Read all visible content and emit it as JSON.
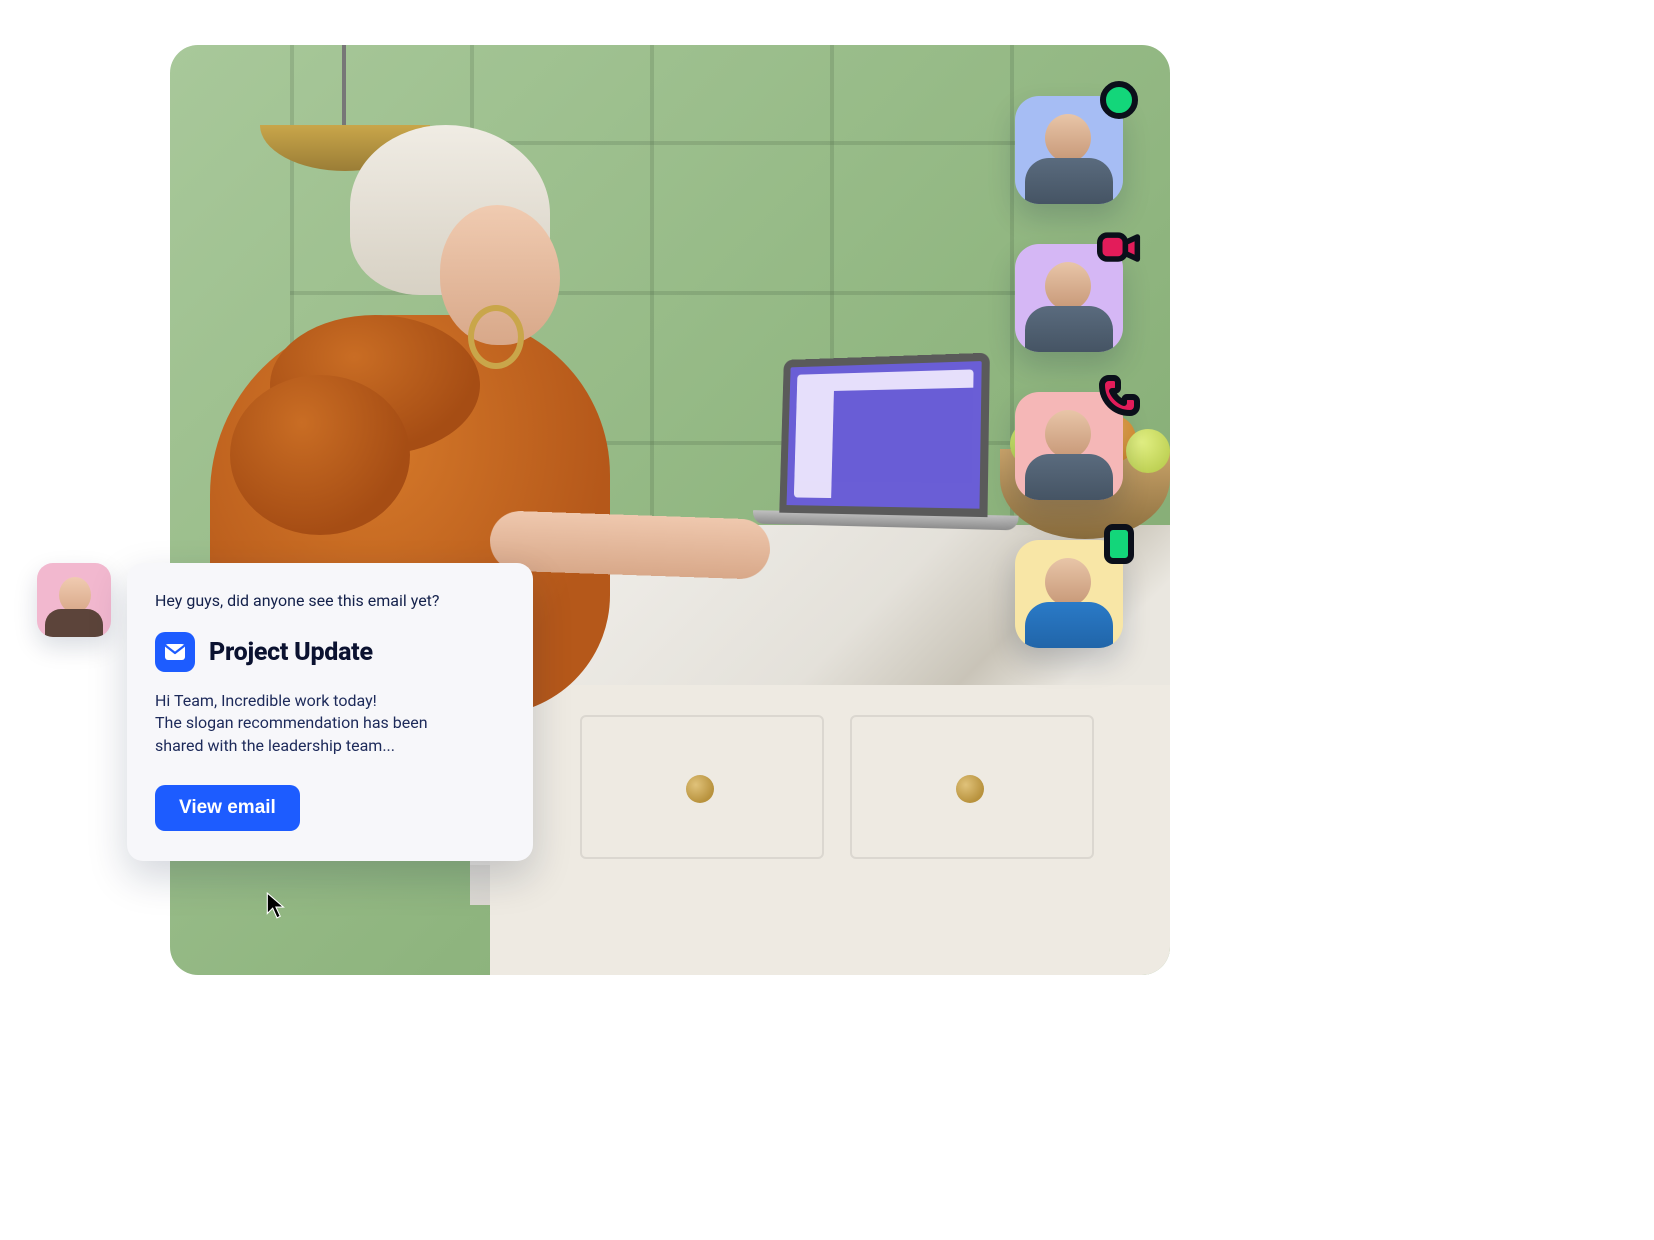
{
  "card": {
    "intro": "Hey guys, did anyone see this email yet?",
    "subject": "Project Update",
    "body": "Hi Team, Incredible work today!\nThe slogan recommendation has been\nshared with the leadership team...",
    "view_label": "View email"
  },
  "avatars": [
    {
      "name": "participant-1",
      "bg": "#a6bdf4",
      "status": "online"
    },
    {
      "name": "participant-2",
      "bg": "#d5b7f5",
      "status": "video"
    },
    {
      "name": "participant-3",
      "bg": "#f5b7b7",
      "status": "phone"
    },
    {
      "name": "participant-4",
      "bg": "#f8e6a6",
      "status": "mobile"
    }
  ],
  "colors": {
    "primary_blue": "#1d5cff",
    "status_green": "#13d67a",
    "status_red": "#e31c5a",
    "badge_stroke": "#0b0f1a"
  }
}
